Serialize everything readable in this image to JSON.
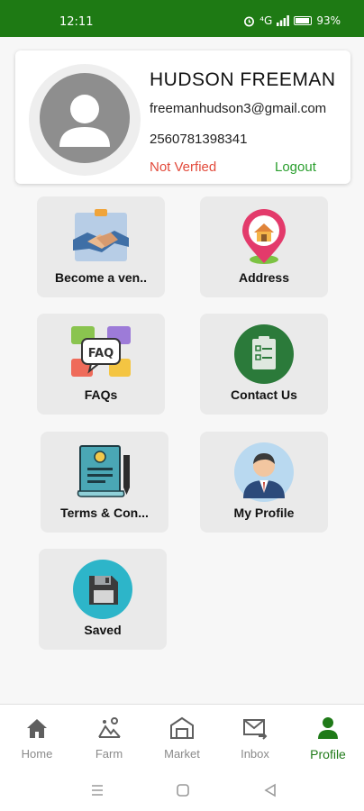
{
  "status_bar": {
    "time": "12:11",
    "network": "⁴G",
    "battery": "93%"
  },
  "profile": {
    "name": "HUDSON FREEMAN",
    "email": "freemanhudson3@gmail.com",
    "phone": "2560781398341",
    "verify_status": "Not Verfied",
    "logout_label": "Logout"
  },
  "tiles": [
    {
      "label": "Become a ven..",
      "icon": "handshake-icon"
    },
    {
      "label": "Address",
      "icon": "location-pin-icon"
    },
    {
      "label": "FAQs",
      "icon": "faq-icon"
    },
    {
      "label": "Contact Us",
      "icon": "clipboard-icon"
    },
    {
      "label": "Terms & Con...",
      "icon": "document-pen-icon"
    },
    {
      "label": "My Profile",
      "icon": "person-icon"
    },
    {
      "label": "Saved",
      "icon": "floppy-disk-icon"
    }
  ],
  "bottom_nav": [
    {
      "label": "Home",
      "icon": "home-icon"
    },
    {
      "label": "Farm",
      "icon": "farm-icon"
    },
    {
      "label": "Market",
      "icon": "market-icon"
    },
    {
      "label": "Inbox",
      "icon": "inbox-icon"
    },
    {
      "label": "Profile",
      "icon": "profile-icon",
      "active": true
    }
  ],
  "colors": {
    "brand_green": "#1e7a14",
    "not_verified": "#e24a3b",
    "logout": "#2a9f2e"
  }
}
